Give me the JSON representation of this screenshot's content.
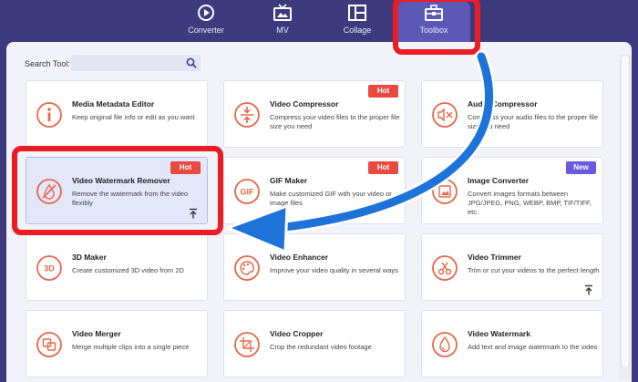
{
  "nav": [
    {
      "label": "Converter",
      "icon": "converter-icon"
    },
    {
      "label": "MV",
      "icon": "mv-icon"
    },
    {
      "label": "Collage",
      "icon": "collage-icon"
    },
    {
      "label": "Toolbox",
      "icon": "toolbox-icon",
      "active": true
    }
  ],
  "search": {
    "label": "Search Tool:",
    "value": ""
  },
  "tools": [
    {
      "title": "Media Metadata Editor",
      "desc": "Keep original file info or edit as you want",
      "icon": "info-icon"
    },
    {
      "title": "Video Compressor",
      "desc": "Compress your video files to the proper file size you need",
      "icon": "compress-icon",
      "badge": "Hot"
    },
    {
      "title": "Audio Compressor",
      "desc": "Compress your audio files to the proper file size you need",
      "icon": "audio-compress-icon"
    },
    {
      "title": "Video Watermark Remover",
      "desc": "Remove the watermark from the video flexibly",
      "icon": "watermark-remove-icon",
      "badge": "Hot"
    },
    {
      "title": "GIF Maker",
      "desc": "Make customized GIF with your video or image files",
      "icon": "gif-icon",
      "badge": "Hot"
    },
    {
      "title": "Image Converter",
      "desc": "Convert images formats between JPG/JPEG, PNG, WEBP, BMP, TIF/TIFF, etc.",
      "icon": "image-convert-icon",
      "badge": "New"
    },
    {
      "title": "3D Maker",
      "desc": "Create customized 3D video from 2D",
      "icon": "3d-icon"
    },
    {
      "title": "Video Enhancer",
      "desc": "Improve your video quality in several ways",
      "icon": "palette-icon"
    },
    {
      "title": "Video Trimmer",
      "desc": "Trim or cut your videos to the perfect length",
      "icon": "scissors-icon"
    },
    {
      "title": "Video Merger",
      "desc": "Merge multiple clips into a single piece",
      "icon": "merge-icon"
    },
    {
      "title": "Video Cropper",
      "desc": "Crop the redundant video footage",
      "icon": "crop-icon"
    },
    {
      "title": "Video Watermark",
      "desc": "Add text and image watermark to the video",
      "icon": "droplet-icon"
    }
  ],
  "colors": {
    "accent": "#e8684a",
    "hot": "#e84a3f",
    "new": "#6b59e0",
    "highlight": "#ec1c24",
    "arrow": "#1e73d8"
  }
}
